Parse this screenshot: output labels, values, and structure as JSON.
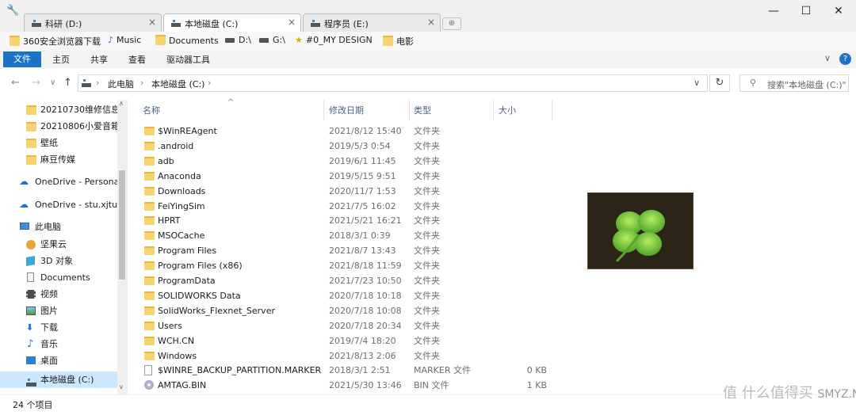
{
  "tabs": [
    {
      "label": "科研 (D:)",
      "close": "×",
      "active": false
    },
    {
      "label": "本地磁盘 (C:)",
      "close": "×",
      "active": true
    },
    {
      "label": "程序员 (E:)",
      "close": "×",
      "active": false
    }
  ],
  "window_controls": {
    "minimize": "—",
    "maximize": "☐",
    "close": "✕"
  },
  "bookmarks": [
    {
      "label": "360安全浏览器下载",
      "icon": "folder-icon"
    },
    {
      "label": "Music",
      "icon": "music-note-icon"
    },
    {
      "label": "Documents",
      "icon": "folder-icon"
    },
    {
      "label": "D:\\",
      "icon": "drive-icon"
    },
    {
      "label": "G:\\",
      "icon": "drive-icon"
    },
    {
      "label": "#0_MY DESIGN",
      "icon": "star-icon"
    },
    {
      "label": "电影",
      "icon": "folder-icon"
    }
  ],
  "ribbon": {
    "tabs": [
      "文件",
      "主页",
      "共享",
      "查看",
      "驱动器工具"
    ],
    "chevron": "∨",
    "help": "?"
  },
  "address": {
    "path": [
      "此电脑",
      "本地磁盘 (C:)"
    ],
    "separator": "›",
    "search_placeholder": "搜索\"本地磁盘 (C:)\"",
    "refresh": "↻",
    "dropdown": "∨"
  },
  "nav_arrows": {
    "back": "←",
    "forward": "→",
    "recent": "∨",
    "up": "↑"
  },
  "nav_pane": [
    {
      "label": "20210730维修信息",
      "icon": "folder-icon"
    },
    {
      "label": "20210806小爱音箱",
      "icon": "folder-icon"
    },
    {
      "label": "壁纸",
      "icon": "folder-icon"
    },
    {
      "label": "麻豆传媒",
      "icon": "folder-icon"
    },
    {
      "label": "OneDrive - Persona",
      "icon": "cloud-icon"
    },
    {
      "label": "OneDrive - stu.xjtu.e",
      "icon": "cloud-icon"
    },
    {
      "label": "此电脑",
      "icon": "computer-icon"
    },
    {
      "label": "坚果云",
      "icon": "nut-cloud-icon"
    },
    {
      "label": "3D 对象",
      "icon": "cube-icon"
    },
    {
      "label": "Documents",
      "icon": "document-icon"
    },
    {
      "label": "视频",
      "icon": "video-icon"
    },
    {
      "label": "图片",
      "icon": "picture-icon"
    },
    {
      "label": "下载",
      "icon": "download-icon"
    },
    {
      "label": "音乐",
      "icon": "music-note-icon"
    },
    {
      "label": "桌面",
      "icon": "desktop-icon"
    },
    {
      "label": "本地磁盘 (C:)",
      "icon": "drive-icon",
      "selected": true
    }
  ],
  "columns": {
    "name": "名称",
    "date": "修改日期",
    "type": "类型",
    "size": "大小",
    "sort_indicator": "^"
  },
  "files": [
    {
      "name": "$WinREAgent",
      "date": "2021/8/12 15:40",
      "type": "文件夹",
      "size": "",
      "kind": "folder"
    },
    {
      "name": ".android",
      "date": "2019/5/3 0:54",
      "type": "文件夹",
      "size": "",
      "kind": "folder"
    },
    {
      "name": "adb",
      "date": "2019/6/1 11:45",
      "type": "文件夹",
      "size": "",
      "kind": "folder"
    },
    {
      "name": "Anaconda",
      "date": "2019/5/15 9:51",
      "type": "文件夹",
      "size": "",
      "kind": "folder"
    },
    {
      "name": "Downloads",
      "date": "2020/11/7 1:53",
      "type": "文件夹",
      "size": "",
      "kind": "folder"
    },
    {
      "name": "FeiYingSim",
      "date": "2021/7/5 16:02",
      "type": "文件夹",
      "size": "",
      "kind": "folder"
    },
    {
      "name": "HPRT",
      "date": "2021/5/21 16:21",
      "type": "文件夹",
      "size": "",
      "kind": "folder"
    },
    {
      "name": "MSOCache",
      "date": "2018/3/1 0:39",
      "type": "文件夹",
      "size": "",
      "kind": "folder"
    },
    {
      "name": "Program Files",
      "date": "2021/8/7 13:43",
      "type": "文件夹",
      "size": "",
      "kind": "folder"
    },
    {
      "name": "Program Files (x86)",
      "date": "2021/8/18 11:59",
      "type": "文件夹",
      "size": "",
      "kind": "folder"
    },
    {
      "name": "ProgramData",
      "date": "2021/7/23 10:50",
      "type": "文件夹",
      "size": "",
      "kind": "folder"
    },
    {
      "name": "SOLIDWORKS Data",
      "date": "2020/7/18 10:18",
      "type": "文件夹",
      "size": "",
      "kind": "folder"
    },
    {
      "name": "SolidWorks_Flexnet_Server",
      "date": "2020/7/18 10:08",
      "type": "文件夹",
      "size": "",
      "kind": "folder"
    },
    {
      "name": "Users",
      "date": "2020/7/18 20:34",
      "type": "文件夹",
      "size": "",
      "kind": "folder"
    },
    {
      "name": "WCH.CN",
      "date": "2019/7/4 18:20",
      "type": "文件夹",
      "size": "",
      "kind": "folder"
    },
    {
      "name": "Windows",
      "date": "2021/8/13 2:06",
      "type": "文件夹",
      "size": "",
      "kind": "folder"
    },
    {
      "name": "$WINRE_BACKUP_PARTITION.MARKER",
      "date": "2018/3/1 2:51",
      "type": "MARKER 文件",
      "size": "0 KB",
      "kind": "file"
    },
    {
      "name": "AMTAG.BIN",
      "date": "2021/5/30 13:46",
      "type": "BIN 文件",
      "size": "1 KB",
      "kind": "disc"
    }
  ],
  "status": {
    "count": "24 个项目"
  },
  "preview": {
    "icon": "four-leaf-clover-icon"
  },
  "watermark": "值 什么值得买",
  "watermark_site": "SMYZ.NET",
  "colors": {
    "accent": "#1a73c6",
    "selection": "#cce8ff",
    "folder": "#f7d371"
  }
}
